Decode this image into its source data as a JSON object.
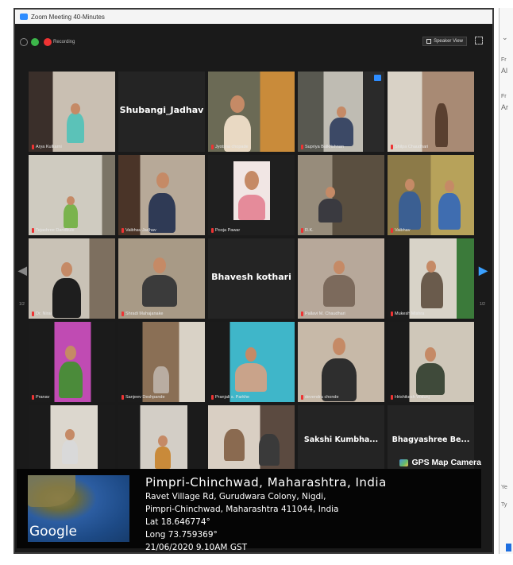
{
  "window": {
    "title": "Zoom Meeting 40-Minutes"
  },
  "toolbar": {
    "recording_label": "Recording",
    "view_label": "Speaker View"
  },
  "pagination": {
    "left": "1/2",
    "right": "1/2"
  },
  "participants": [
    {
      "name": "Arya Kulkarni",
      "video": true
    },
    {
      "name": "",
      "display": "Shubangi_Jadhav",
      "video": false
    },
    {
      "name": "Jyotsna chopade",
      "video": true
    },
    {
      "name": "Supriya Balkrishnan",
      "video": true,
      "active": true
    },
    {
      "name": "Shilpa Chaudhari",
      "video": true
    },
    {
      "name": "Tejashree Dandkule",
      "video": true
    },
    {
      "name": "Vaibhav Jadhav",
      "video": true
    },
    {
      "name": "Pooja Pawar",
      "video": true
    },
    {
      "name": "R.K.",
      "video": true
    },
    {
      "name": "Vaibhav",
      "video": true
    },
    {
      "name": "Dr. Nirai",
      "video": true
    },
    {
      "name": "Shradi Mahajanake",
      "video": true
    },
    {
      "name": "",
      "display": "Bhavesh kothari",
      "video": false
    },
    {
      "name": "Pallavi M. Chaudhari",
      "video": true
    },
    {
      "name": "Mukesh Mishra",
      "video": true
    },
    {
      "name": "Pranav",
      "video": true
    },
    {
      "name": "Sanjeev Deshpande",
      "video": true
    },
    {
      "name": "Pranjali s. Parkhe",
      "video": true
    },
    {
      "name": "devendra chonde",
      "video": true
    },
    {
      "name": "Hrishikesh Walunj",
      "video": true
    },
    {
      "name": "",
      "video": true
    },
    {
      "name": "",
      "video": true
    },
    {
      "name": "",
      "video": true
    },
    {
      "name": "",
      "display": "Sakshi Kumbha...",
      "video": false
    },
    {
      "name": "",
      "display": "Bhagyashree Be...",
      "video": false
    }
  ],
  "gps": {
    "app_label": "GPS Map Camera",
    "map_brand": "Google",
    "city": "Pimpri-Chinchwad, Maharashtra, India",
    "address_line1": "Ravet Village Rd, Gurudwara Colony, Nigdi,",
    "address_line2": "Pimpri-Chinchwad, Maharashtra 411044, India",
    "lat": "Lat 18.646774°",
    "long": "Long 73.759369°",
    "datetime": "21/06/2020 9.10AM GST"
  },
  "side_panel": {
    "text1": "Fr",
    "text2": "Al",
    "text3": "Fr",
    "text4": "Ar",
    "text5": "Ye",
    "text6": "Ty"
  },
  "colors": {
    "accent": "#2d8cff",
    "active_border": "#d3c94a",
    "meeting_bg": "#1a1a1a"
  }
}
